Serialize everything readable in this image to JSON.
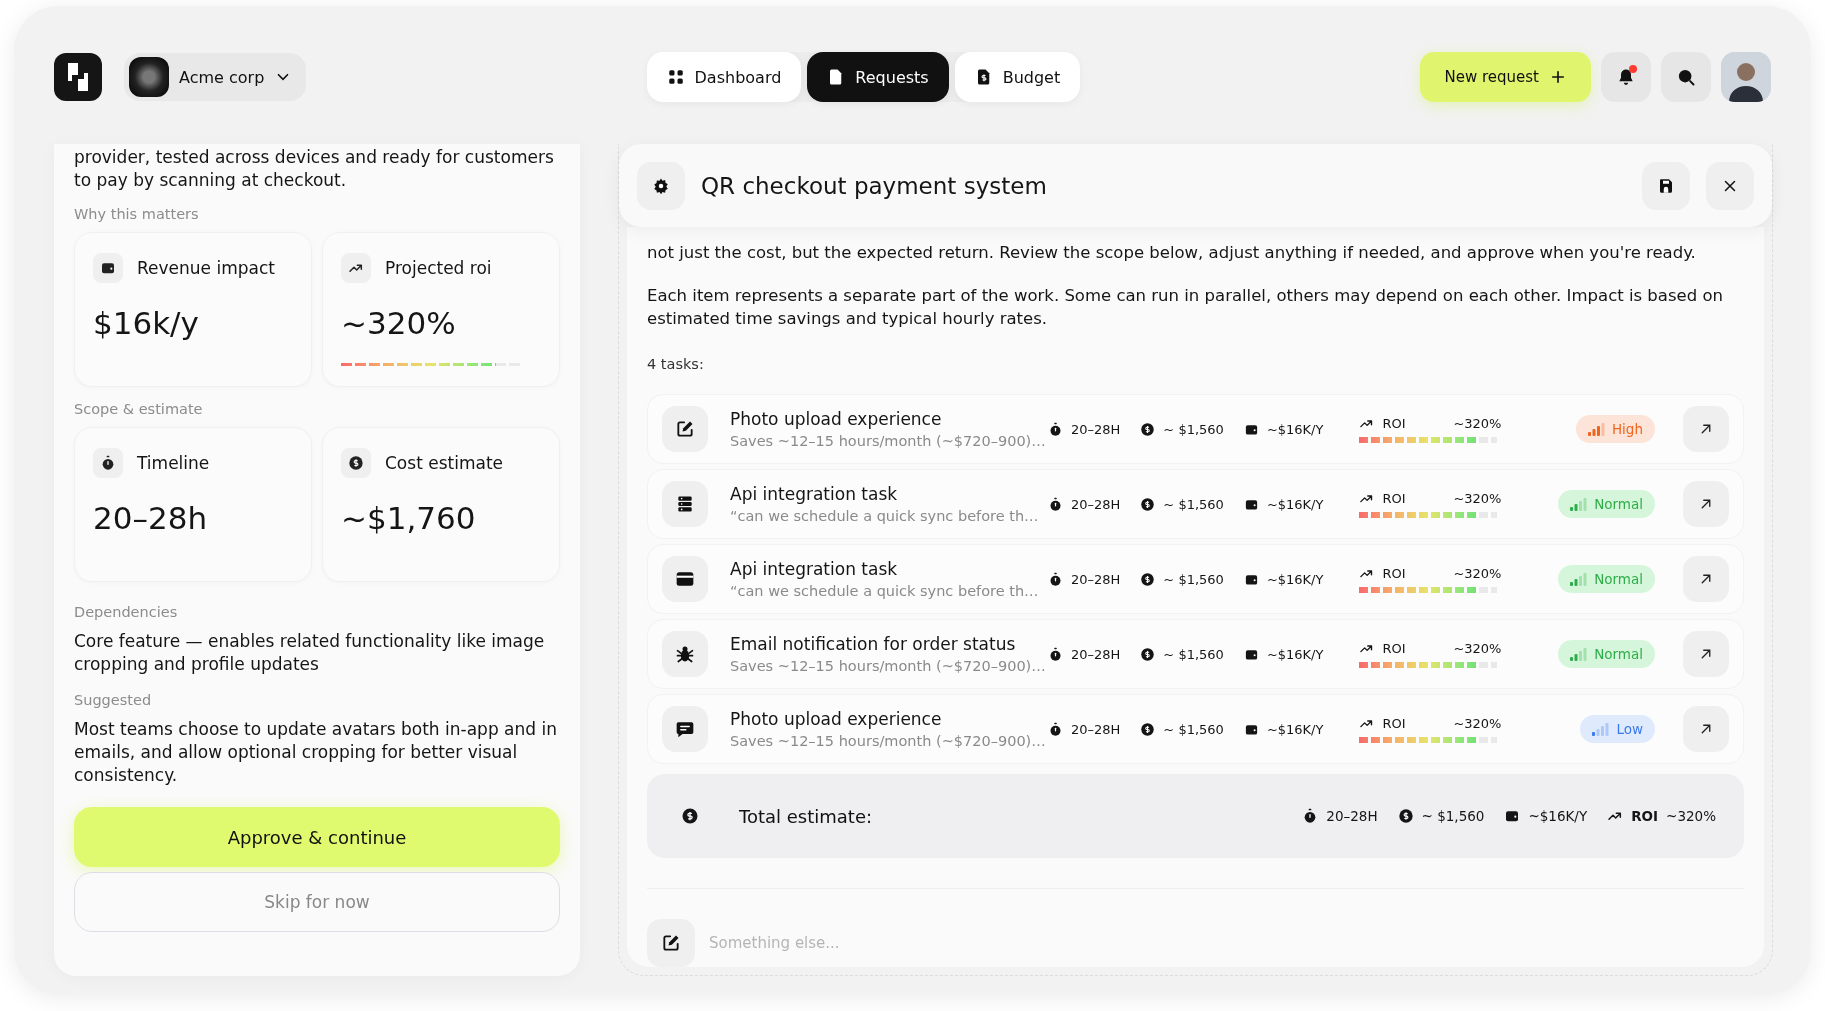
{
  "header": {
    "org": "Acme corp",
    "nav": [
      {
        "label": "Dashboard",
        "selected": false
      },
      {
        "label": "Requests",
        "selected": true
      },
      {
        "label": "Budget",
        "selected": false
      }
    ],
    "new_request": "New request",
    "notifications": {
      "unread": true
    }
  },
  "details": {
    "intro": "provider, tested across devices and ready for customers to pay by scanning at checkout.",
    "why_label": "Why this matters",
    "impact_cards": [
      {
        "label": "Revenue impact",
        "value": "$16k/y"
      },
      {
        "label": "Projected roi",
        "value": "~320%",
        "level": 0.85
      }
    ],
    "scope_label": "Scope & estimate",
    "scope_cards": [
      {
        "label": "Timeline",
        "value": "20–28h"
      },
      {
        "label": "Cost estimate",
        "value": "~$1,760"
      }
    ],
    "dependencies_label": "Dependencies",
    "dependencies": "Core feature — enables related functionality like image cropping and profile updates",
    "suggested_label": "Suggested",
    "suggested": "Most teams choose to update avatars both in-app and in emails, and allow optional cropping for better visual consistency.",
    "approve_button": "Approve & continue",
    "skip_button": "Skip for now"
  },
  "request": {
    "title": "QR checkout payment system",
    "description": "not just the cost, but the expected return. Review the scope below, adjust anything if needed, and approve when you're ready.",
    "note": "Each item represents a separate part of the work. Some can run in parallel, others may depend on each other. Impact is based on estimated time savings and typical hourly rates.",
    "task_count": "4 tasks:",
    "tasks": [
      {
        "title": "Photo upload experience",
        "subtitle": "Saves ~12–15 hours/month (~$720–900)…",
        "time": "20–28H",
        "cost": "~ $1,560",
        "impact": "~$16K/Y",
        "roi_label": "ROI",
        "roi": "~320%",
        "level": 0.85,
        "priority": {
          "kind": "high",
          "label": "High"
        }
      },
      {
        "title": "Api integration task",
        "subtitle": "“can we schedule a quick sync before th…",
        "time": "20–28H",
        "cost": "~ $1,560",
        "impact": "~$16K/Y",
        "roi_label": "ROI",
        "roi": "~320%",
        "level": 0.85,
        "priority": {
          "kind": "normal",
          "label": "Normal"
        }
      },
      {
        "title": "Api integration task",
        "subtitle": "“can we schedule a quick sync before th…",
        "time": "20–28H",
        "cost": "~ $1,560",
        "impact": "~$16K/Y",
        "roi_label": "ROI",
        "roi": "~320%",
        "level": 0.85,
        "priority": {
          "kind": "normal",
          "label": "Normal"
        }
      },
      {
        "title": "Email notification for order status",
        "subtitle": "Saves ~12–15 hours/month (~$720–900)…",
        "time": "20–28H",
        "cost": "~ $1,560",
        "impact": "~$16K/Y",
        "roi_label": "ROI",
        "roi": "~320%",
        "level": 0.85,
        "priority": {
          "kind": "normal",
          "label": "Normal"
        }
      },
      {
        "title": "Photo upload experience",
        "subtitle": "Saves ~12–15 hours/month (~$720–900)…",
        "time": "20–28H",
        "cost": "~ $1,560",
        "impact": "~$16K/Y",
        "roi_label": "ROI",
        "roi": "~320%",
        "level": 0.85,
        "priority": {
          "kind": "low",
          "label": "Low"
        }
      }
    ],
    "total": {
      "label": "Total estimate:",
      "time": "20–28H",
      "cost": "~ $1,560",
      "impact": "~$16K/Y",
      "roi_label": "ROI",
      "roi": "~320%"
    },
    "input": {
      "placeholder": "Something else..."
    }
  }
}
